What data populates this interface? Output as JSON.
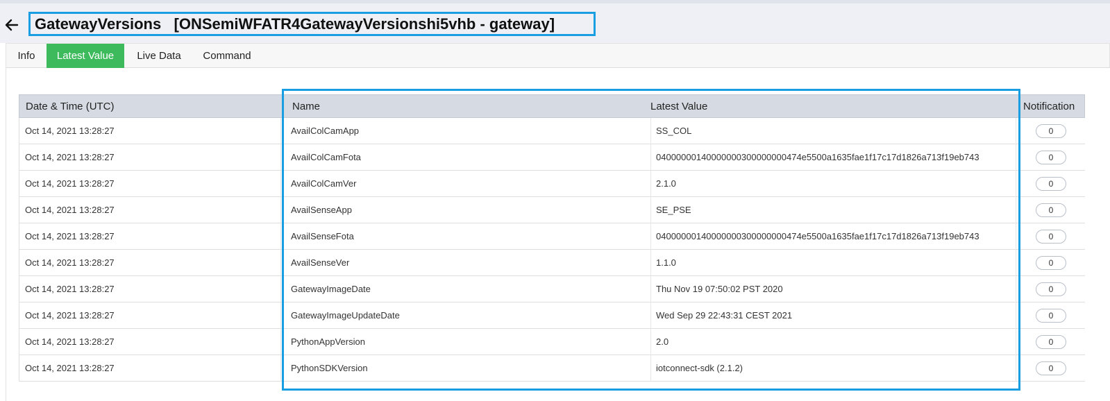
{
  "header": {
    "title": "GatewayVersions   [ONSemiWFATR4GatewayVersionshi5vhb - gateway]",
    "back_icon": "arrow-left-icon"
  },
  "tabs": [
    {
      "label": "Info",
      "active": false
    },
    {
      "label": "Latest Value",
      "active": true
    },
    {
      "label": "Live Data",
      "active": false
    },
    {
      "label": "Command",
      "active": false
    }
  ],
  "colors": {
    "accent": "#3dba5c",
    "highlight": "#1a9ee2"
  },
  "table": {
    "columns": [
      "Date & Time (UTC)",
      "Name",
      "Latest Value",
      "Notification"
    ],
    "rows": [
      {
        "datetime": "Oct 14, 2021 13:28:27",
        "name": "AvailColCamApp",
        "value": "SS_COL",
        "notification": "0"
      },
      {
        "datetime": "Oct 14, 2021 13:28:27",
        "name": "AvailColCamFota",
        "value": "04000000140000000300000000474e5500a1635fae1f17c17d1826a713f19eb743",
        "notification": "0"
      },
      {
        "datetime": "Oct 14, 2021 13:28:27",
        "name": "AvailColCamVer",
        "value": "2.1.0",
        "notification": "0"
      },
      {
        "datetime": "Oct 14, 2021 13:28:27",
        "name": "AvailSenseApp",
        "value": "SE_PSE",
        "notification": "0"
      },
      {
        "datetime": "Oct 14, 2021 13:28:27",
        "name": "AvailSenseFota",
        "value": "04000000140000000300000000474e5500a1635fae1f17c17d1826a713f19eb743",
        "notification": "0"
      },
      {
        "datetime": "Oct 14, 2021 13:28:27",
        "name": "AvailSenseVer",
        "value": "1.1.0",
        "notification": "0"
      },
      {
        "datetime": "Oct 14, 2021 13:28:27",
        "name": "GatewayImageDate",
        "value": "Thu Nov 19 07:50:02 PST 2020",
        "notification": "0"
      },
      {
        "datetime": "Oct 14, 2021 13:28:27",
        "name": "GatewayImageUpdateDate",
        "value": "Wed Sep 29 22:43:31 CEST 2021",
        "notification": "0"
      },
      {
        "datetime": "Oct 14, 2021 13:28:27",
        "name": "PythonAppVersion",
        "value": "2.0",
        "notification": "0"
      },
      {
        "datetime": "Oct 14, 2021 13:28:27",
        "name": "PythonSDKVersion",
        "value": "iotconnect-sdk (2.1.2)",
        "notification": "0"
      }
    ]
  }
}
